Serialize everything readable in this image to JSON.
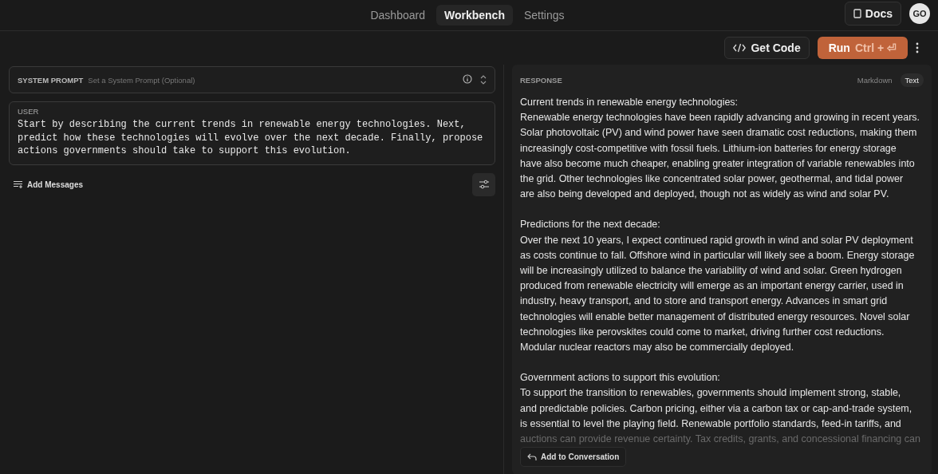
{
  "nav": {
    "tabs": [
      {
        "label": "Dashboard",
        "selected": false
      },
      {
        "label": "Workbench",
        "selected": true
      },
      {
        "label": "Settings",
        "selected": false
      }
    ],
    "docs": "Docs",
    "avatar": "GO"
  },
  "toolbar": {
    "get_code": "Get Code",
    "run": {
      "label": "Run",
      "shortcut": "Ctrl + ⏎"
    }
  },
  "system_prompt": {
    "label": "SYSTEM PROMPT",
    "placeholder": "Set a System Prompt (Optional)"
  },
  "user_message": {
    "role": "USER",
    "lines": [
      "Start by describing the current trends in renewable energy technologies. Next,",
      "predict how these technologies will evolve over the next decade. Finally, propose",
      "actions governments should take to support this evolution."
    ]
  },
  "add_messages": "Add Messages",
  "response": {
    "label": "RESPONSE",
    "formats": [
      {
        "label": "Markdown",
        "selected": false
      },
      {
        "label": "Text",
        "selected": true
      }
    ],
    "sections": [
      {
        "lines": [
          "Current trends in renewable energy technologies:",
          "Renewable energy technologies have been rapidly advancing and growing in recent years.",
          "Solar photovoltaic (PV) and wind power have seen dramatic cost reductions, making them",
          "increasingly cost-competitive with fossil fuels. Lithium-ion batteries for energy storage",
          "have also become much cheaper, enabling greater integration of variable renewables into",
          "the grid. Other technologies like concentrated solar power, geothermal, and tidal power",
          "are also being developed and deployed, though not as widely as wind and solar PV."
        ]
      },
      {
        "lines": [
          "Predictions for the next decade:",
          "Over the next 10 years, I expect continued rapid growth in wind and solar PV deployment",
          "as costs continue to fall. Offshore wind in particular will likely see a boom. Energy storage",
          "will be increasingly utilized to balance the variability of wind and solar. Green hydrogen",
          "produced from renewable electricity will emerge as an important energy carrier, used in",
          "industry, heavy transport, and to store and transport energy. Advances in smart grid",
          "technologies will enable better management of distributed energy resources. Novel solar",
          "technologies like perovskites could come to market, driving further cost reductions.",
          "Modular nuclear reactors may also be commercially deployed."
        ]
      },
      {
        "lines": [
          "Government actions to support this evolution:",
          "To support the transition to renewables, governments should implement strong, stable,",
          "and predictable policies. Carbon pricing, either via a carbon tax or cap-and-trade system,",
          "is essential to level the playing field. Renewable portfolio standards, feed-in tariffs, and",
          "auctions can provide revenue certainty. Tax credits, grants, and concessional financing can"
        ]
      }
    ],
    "add_to_conversation": "Add to Conversation"
  }
}
